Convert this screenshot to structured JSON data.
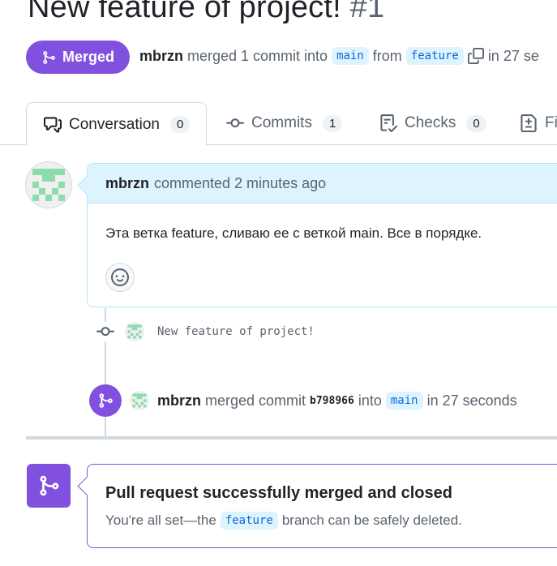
{
  "pr": {
    "title": "New feature of project!",
    "number": "#1",
    "state": "Merged",
    "author": "mbrzn",
    "merge_summary": "merged 1 commit into",
    "base_branch": "main",
    "from_word": "from",
    "head_branch": "feature",
    "time": "in 27 se"
  },
  "tabs": [
    {
      "label": "Conversation",
      "count": "0",
      "icon": "comment-discussion-icon"
    },
    {
      "label": "Commits",
      "count": "1",
      "icon": "git-commit-icon"
    },
    {
      "label": "Checks",
      "count": "0",
      "icon": "checklist-icon"
    },
    {
      "label": "Fi",
      "count": "",
      "icon": "file-diff-icon"
    }
  ],
  "comment": {
    "author": "mbrzn",
    "meta": "commented 2 minutes ago",
    "body": "Эта ветка feature, сливаю ее с веткой main. Все в порядке."
  },
  "commit": {
    "message": "New feature of project!"
  },
  "merge_event": {
    "author": "mbrzn",
    "action": "merged commit",
    "sha": "b798966",
    "into": "into",
    "branch": "main",
    "time": "in 27 seconds"
  },
  "merged_box": {
    "title": "Pull request successfully merged and closed",
    "sub_before": "You're all set—the",
    "branch": "feature",
    "sub_after": "branch can be safely deleted."
  },
  "colors": {
    "merged": "#8250df",
    "branch_bg": "#ddf4ff",
    "branch_fg": "#0969da",
    "avatar_green": "#8ddcad"
  }
}
